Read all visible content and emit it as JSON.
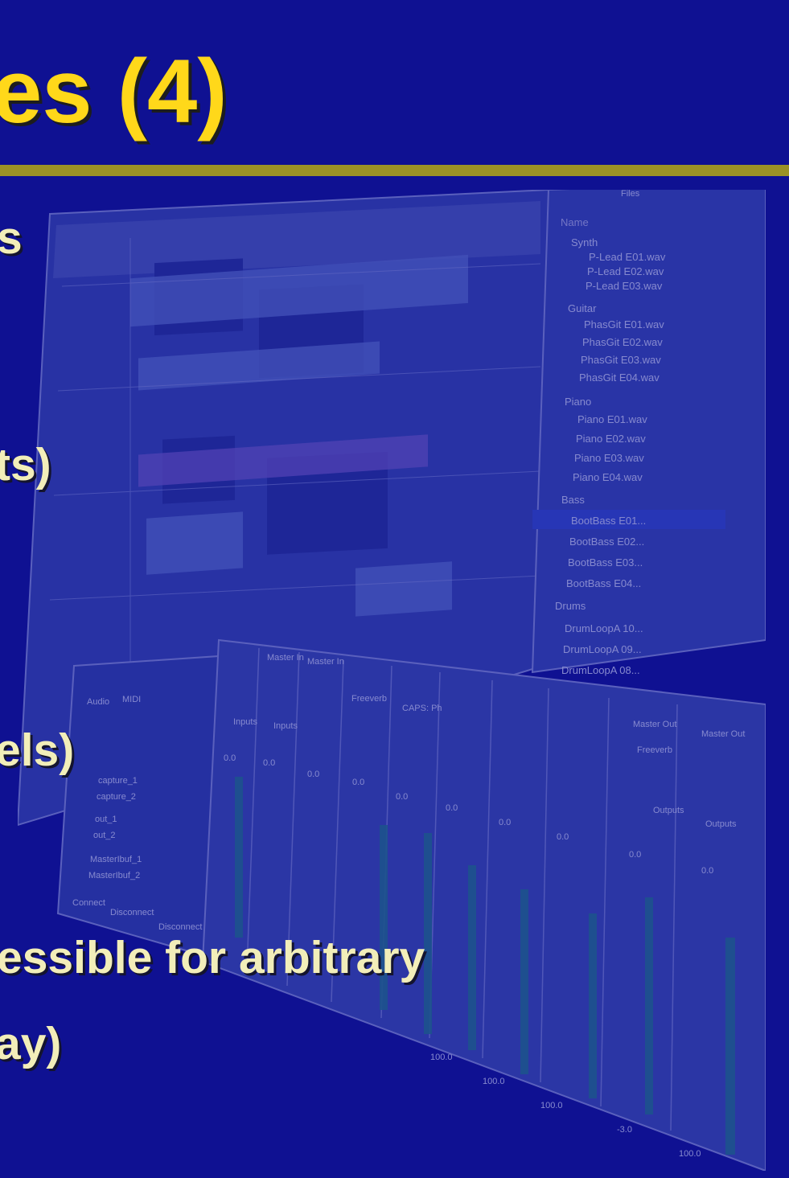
{
  "slide": {
    "title": "es (4)",
    "bullets": [
      "s",
      "ts)",
      "els)",
      "essible for arbitrary",
      "ay)"
    ]
  },
  "file_browser": {
    "title": "Files",
    "column_header": "Name",
    "groups": [
      {
        "name": "Synth",
        "files": [
          "P-Lead E01.wav",
          "P-Lead E02.wav",
          "P-Lead E03.wav"
        ]
      },
      {
        "name": "Guitar",
        "files": [
          "PhasGit E01.wav",
          "PhasGit E02.wav",
          "PhasGit E03.wav",
          "PhasGit E04.wav"
        ]
      },
      {
        "name": "Piano",
        "files": [
          "Piano E01.wav",
          "Piano E02.wav",
          "Piano E03.wav",
          "Piano E04.wav"
        ]
      },
      {
        "name": "Bass",
        "files": [
          "BootBass E01...",
          "BootBass E02...",
          "BootBass E03...",
          "BootBass E04..."
        ]
      },
      {
        "name": "Drums",
        "files": [
          "DrumLoopA 10...",
          "DrumLoopA 09...",
          "DrumLoopA 08..."
        ]
      }
    ]
  },
  "mixer": {
    "strip_labels": [
      "Master In",
      "Master In",
      "Master Out",
      "Master Out"
    ],
    "insert_labels": [
      "Freeverb",
      "CAPS: Ph",
      "Freeverb"
    ],
    "io_labels": [
      "Inputs",
      "Inputs",
      "Outputs",
      "Outputs"
    ],
    "gain_values": [
      "0.0",
      "0.0",
      "0.0",
      "0.0",
      "0.0",
      "0.0",
      "0.0",
      "0.0",
      "0.0",
      "0.0"
    ],
    "volume_values": [
      "100.0",
      "100.0",
      "100.0",
      "-3.0",
      "100.0"
    ]
  },
  "connections": {
    "tabs": [
      "Audio",
      "MIDI"
    ],
    "tree": [
      "capture_1",
      "capture_2",
      "out_1",
      "out_2",
      "MasterIbuf_1",
      "MasterIbuf_2"
    ],
    "buttons": [
      "Connect",
      "Disconnect",
      "Disconnect All"
    ]
  },
  "colors": {
    "background": "#0f1192",
    "title": "#ffd81a",
    "rule": "#9b9226",
    "bullet_text": "#f2eeb9",
    "selection": "#3c56d4"
  }
}
